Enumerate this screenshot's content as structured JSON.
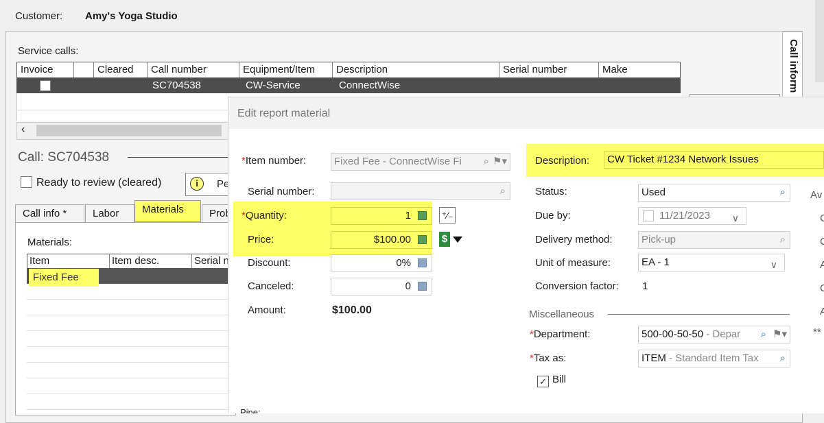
{
  "customer": {
    "label": "Customer:",
    "name": "Amy's Yoga Studio"
  },
  "service_calls": {
    "label": "Service calls:",
    "columns": [
      "Invoice",
      "",
      "Cleared",
      "Call number",
      "Equipment/Item",
      "Description",
      "Serial number",
      "Make"
    ],
    "rows": [
      {
        "call_number": "SC704538",
        "equipment": "CW-Service",
        "description": "ConnectWise"
      }
    ]
  },
  "side_tab": {
    "label": "Call inform"
  },
  "call": {
    "title": "Call: SC704538",
    "ready_label": "Ready to review (cleared)",
    "pe_label": "Pe"
  },
  "tabs": [
    "Call info *",
    "Labor",
    "Materials",
    "Prob"
  ],
  "materials": {
    "label": "Materials:",
    "columns": [
      "Item",
      "Item desc.",
      "Serial n"
    ],
    "rows": [
      {
        "item": "Fixed Fee"
      }
    ]
  },
  "dialog": {
    "title": "Edit report material",
    "item_number": {
      "label": "Item number:",
      "value": "Fixed Fee - ConnectWise Fi"
    },
    "serial_number": {
      "label": "Serial number:",
      "value": ""
    },
    "quantity": {
      "label": "Quantity:",
      "value": "1"
    },
    "price": {
      "label": "Price:",
      "value": "$100.00"
    },
    "discount": {
      "label": "Discount:",
      "value": "0%"
    },
    "canceled": {
      "label": "Canceled:",
      "value": "0"
    },
    "amount": {
      "label": "Amount:",
      "value": "$100.00"
    },
    "description": {
      "label": "Description:",
      "value": "CW Ticket #1234 Network Issues"
    },
    "status": {
      "label": "Status:",
      "value": "Used"
    },
    "due_by": {
      "label": "Due by:",
      "value": "11/21/2023"
    },
    "delivery_method": {
      "label": "Delivery method:",
      "value": "Pick-up"
    },
    "unit_of_measure": {
      "label": "Unit of measure:",
      "value": "EA - 1"
    },
    "conversion_factor": {
      "label": "Conversion factor:",
      "value": "1"
    },
    "misc_label": "Miscellaneous",
    "department": {
      "label": "Department:",
      "code": "500-00-50-50",
      "desc": " - Depar"
    },
    "tax_as": {
      "label": "Tax as:",
      "code": "ITEM",
      "desc": " - Standard Item Tax"
    },
    "bill_label": "Bill",
    "bottom_partial": "Pine:",
    "right_fragments": [
      "Av",
      "C",
      "C",
      "A",
      "C",
      "A",
      "**"
    ]
  },
  "colors": {
    "highlight": "#ffff66",
    "row_selected": "#4d4d4d",
    "required": "#d32f2f"
  }
}
